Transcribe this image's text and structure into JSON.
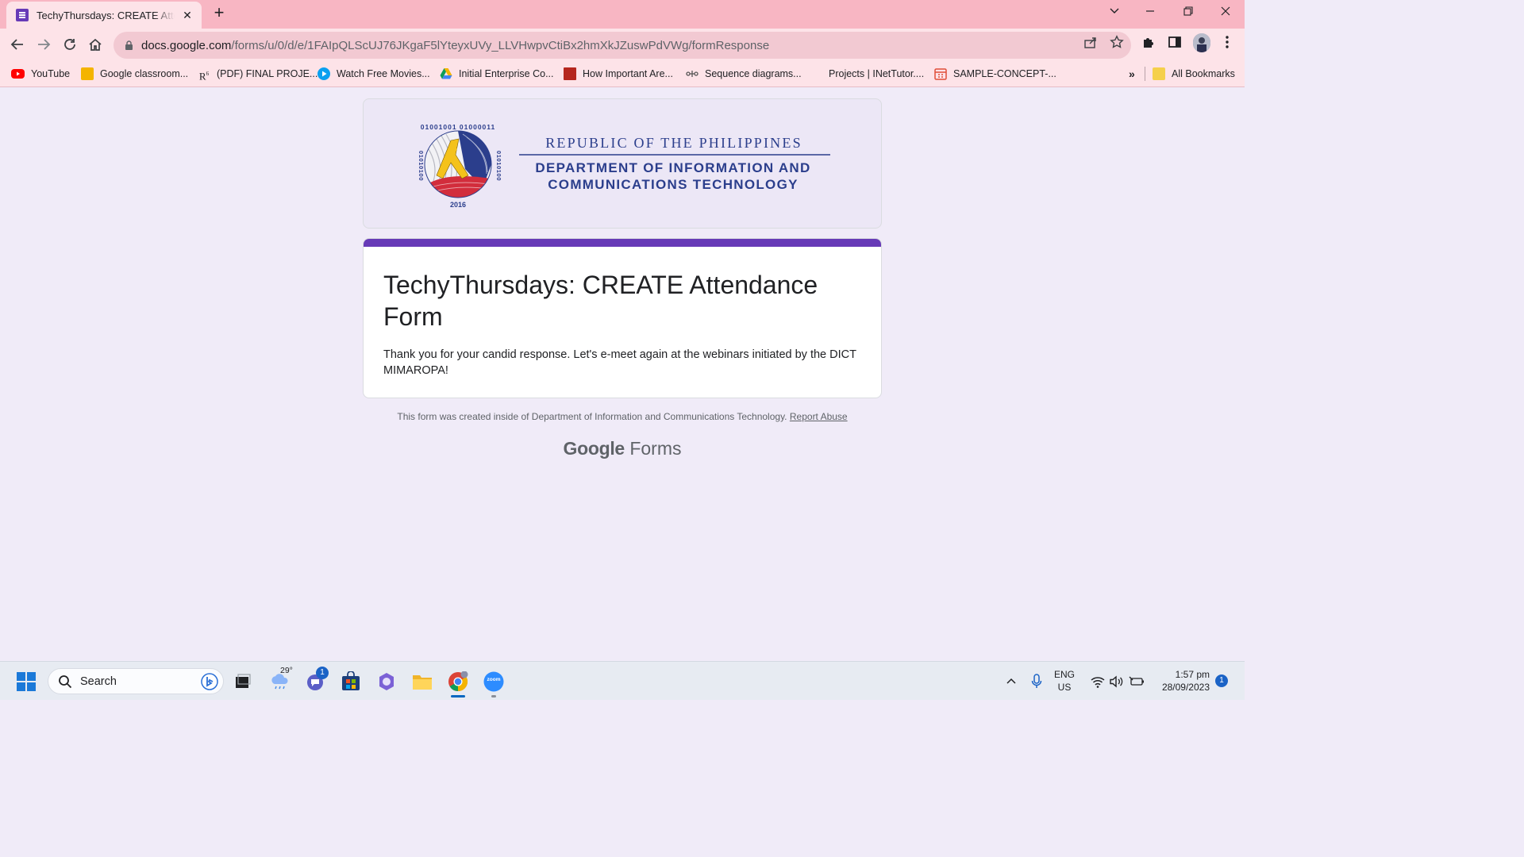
{
  "browser": {
    "tab_title": "TechyThursdays: CREATE Attendance Form",
    "url_host": "docs.google.com",
    "url_path": "/forms/u/0/d/e/1FAIpQLScUJ76JKgaF5lYteyxUVy_LLVHwpvCtiBx2hmXkJZuswPdVWg/formResponse"
  },
  "bookmarks": {
    "items": [
      {
        "label": "YouTube",
        "color": "#ff0000"
      },
      {
        "label": "Google classroom...",
        "color": "#f4b400"
      },
      {
        "label": "(PDF) FINAL PROJE...",
        "color": "#ffffff"
      },
      {
        "label": "Watch Free Movies...",
        "color": "#0aa0f0"
      },
      {
        "label": "Initial Enterprise Co...",
        "color": "#0f9d58"
      },
      {
        "label": "How Important Are...",
        "color": "#b5261e"
      },
      {
        "label": "Sequence diagrams...",
        "color": "#555555"
      },
      {
        "label": "Projects | INetTutor....",
        "color": ""
      },
      {
        "label": "SAMPLE-CONCEPT-...",
        "color": "#e04e39"
      }
    ],
    "overflow": "»",
    "all_bookmarks": "All Bookmarks"
  },
  "header": {
    "logo_top_digits": "01001001 01000011",
    "logo_side_digits": "01010100",
    "logo_year": "2016",
    "republic": "REPUBLIC OF THE PHILIPPINES",
    "dept_line1": "DEPARTMENT OF INFORMATION AND",
    "dept_line2": "COMMUNICATIONS TECHNOLOGY"
  },
  "form": {
    "title": "TechyThursdays: CREATE Attendance Form",
    "message": "Thank you for your candid response. Let's e-meet again at the webinars initiated by the DICT MIMAROPA!",
    "accent_color": "#673ab7"
  },
  "footer": {
    "created_text": "This form was created inside of Department of Information and Communications Technology.",
    "report_link": "Report Abuse",
    "brand_google": "Google",
    "brand_forms": "Forms"
  },
  "taskbar": {
    "search_label": "Search",
    "weather_temp": "29°",
    "chat_badge": "1",
    "zoom_label": "zoom",
    "lang_line1": "ENG",
    "lang_line2": "US",
    "time": "1:57 pm",
    "date": "28/09/2023",
    "notification_count": "1"
  }
}
